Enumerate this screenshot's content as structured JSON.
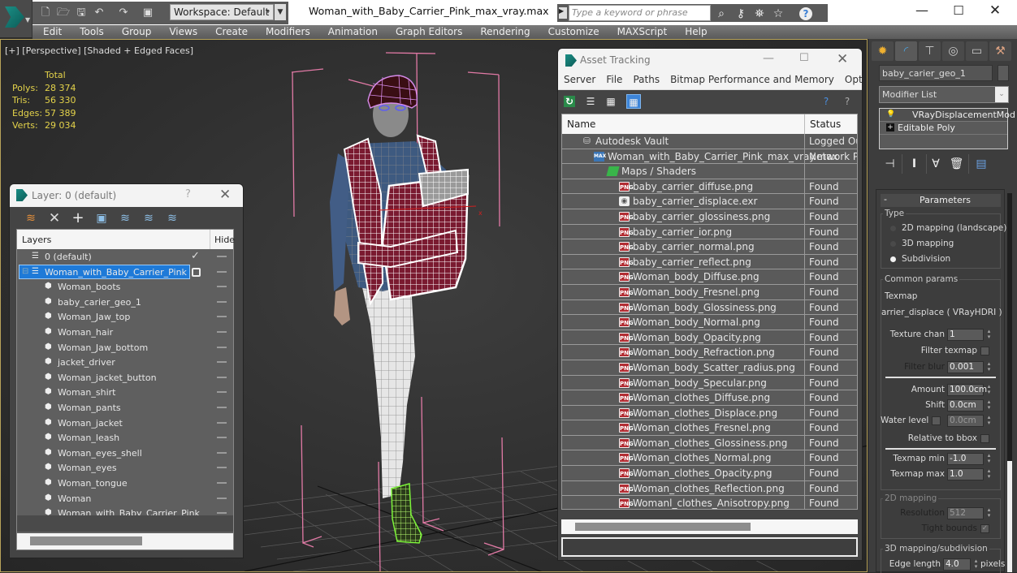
{
  "app": {
    "window_title": "Woman_with_Baby_Carrier_Pink_max_vray.max",
    "workspace": "Workspace: Default",
    "search_placeholder": "Type a keyword or phrase",
    "window_controls": {
      "minimize": "—",
      "maximize": "☐",
      "close": "✕"
    }
  },
  "menu": [
    "Edit",
    "Tools",
    "Group",
    "Views",
    "Create",
    "Modifiers",
    "Animation",
    "Graph Editors",
    "Rendering",
    "Customize",
    "MAXScript",
    "Help"
  ],
  "quick_access_icons": [
    "new-file",
    "open-file",
    "save",
    "undo",
    "redo",
    "project-folder"
  ],
  "toolbar_right_icons": [
    "binoculars",
    "key",
    "satellite",
    "star",
    "help"
  ],
  "viewport": {
    "label": "[+] [Perspective] [Shaded + Edged Faces]",
    "stats": {
      "header": "Total",
      "rows": [
        {
          "label": "Polys:",
          "value": "28 374"
        },
        {
          "label": "Tris:",
          "value": "56 330"
        },
        {
          "label": "Edges:",
          "value": "57 389"
        },
        {
          "label": "Verts:",
          "value": "29 034"
        }
      ]
    },
    "axis_label": "x"
  },
  "layer_dialog": {
    "title": "Layer: 0 (default)",
    "help": "?",
    "close": "✕",
    "tools": [
      "create-layer",
      "delete-layer",
      "add-to-layer",
      "select-objects",
      "highlight-selected",
      "hide-all",
      "freeze-all"
    ],
    "columns": {
      "layers": "Layers",
      "hide": "Hide"
    },
    "rows": [
      {
        "name": "0 (default)",
        "type": "layer",
        "indent": 1,
        "checked": true,
        "selected": false
      },
      {
        "name": "Woman_with_Baby_Carrier_Pink",
        "type": "layer",
        "indent": 1,
        "checked": false,
        "selected": true
      },
      {
        "name": "Woman_boots",
        "type": "object",
        "indent": 2
      },
      {
        "name": "baby_carier_geo_1",
        "type": "object",
        "indent": 2
      },
      {
        "name": "Woman_Jaw_top",
        "type": "object",
        "indent": 2
      },
      {
        "name": "Woman_hair",
        "type": "object",
        "indent": 2
      },
      {
        "name": "Woman_Jaw_bottom",
        "type": "object",
        "indent": 2
      },
      {
        "name": "jacket_driver",
        "type": "object",
        "indent": 2
      },
      {
        "name": "Woman_jacket_button",
        "type": "object",
        "indent": 2
      },
      {
        "name": "Woman_shirt",
        "type": "object",
        "indent": 2
      },
      {
        "name": "Woman_pants",
        "type": "object",
        "indent": 2
      },
      {
        "name": "Woman_jacket",
        "type": "object",
        "indent": 2
      },
      {
        "name": "Woman_leash",
        "type": "object",
        "indent": 2
      },
      {
        "name": "Woman_eyes_shell",
        "type": "object",
        "indent": 2
      },
      {
        "name": "Woman_eyes",
        "type": "object",
        "indent": 2
      },
      {
        "name": "Woman_tongue",
        "type": "object",
        "indent": 2
      },
      {
        "name": "Woman",
        "type": "object",
        "indent": 2
      },
      {
        "name": "Woman_with_Baby_Carrier_Pink",
        "type": "object",
        "indent": 2
      }
    ]
  },
  "asset_tracking": {
    "title": "Asset Tracking",
    "menu": [
      "Server",
      "File",
      "Paths",
      "Bitmap Performance and Memory",
      "Options"
    ],
    "columns": {
      "name": "Name",
      "status": "Status"
    },
    "rows": [
      {
        "name": "Autodesk Vault",
        "status": "Logged Out",
        "icon": "vault",
        "indent": 1
      },
      {
        "name": "Woman_with_Baby_Carrier_Pink_max_vray.max",
        "status": "Network Pa",
        "icon": "max",
        "indent": 2
      },
      {
        "name": "Maps / Shaders",
        "status": "",
        "icon": "maps",
        "indent": 3
      },
      {
        "name": "baby_carrier_diffuse.png",
        "status": "Found",
        "icon": "png",
        "indent": 4
      },
      {
        "name": "baby_carrier_displace.exr",
        "status": "Found",
        "icon": "exr",
        "indent": 4
      },
      {
        "name": "baby_carrier_glossiness.png",
        "status": "Found",
        "icon": "png",
        "indent": 4
      },
      {
        "name": "baby_carrier_ior.png",
        "status": "Found",
        "icon": "png",
        "indent": 4
      },
      {
        "name": "baby_carrier_normal.png",
        "status": "Found",
        "icon": "png",
        "indent": 4
      },
      {
        "name": "baby_carrier_reflect.png",
        "status": "Found",
        "icon": "png",
        "indent": 4
      },
      {
        "name": "Woman_body_Diffuse.png",
        "status": "Found",
        "icon": "png",
        "indent": 4
      },
      {
        "name": "Woman_body_Fresnel.png",
        "status": "Found",
        "icon": "png",
        "indent": 4
      },
      {
        "name": "Woman_body_Glossiness.png",
        "status": "Found",
        "icon": "png",
        "indent": 4
      },
      {
        "name": "Woman_body_Normal.png",
        "status": "Found",
        "icon": "png",
        "indent": 4
      },
      {
        "name": "Woman_body_Opacity.png",
        "status": "Found",
        "icon": "png",
        "indent": 4
      },
      {
        "name": "Woman_body_Refraction.png",
        "status": "Found",
        "icon": "png",
        "indent": 4
      },
      {
        "name": "Woman_body_Scatter_radius.png",
        "status": "Found",
        "icon": "png",
        "indent": 4
      },
      {
        "name": "Woman_body_Specular.png",
        "status": "Found",
        "icon": "png",
        "indent": 4
      },
      {
        "name": "Woman_clothes_Diffuse.png",
        "status": "Found",
        "icon": "png",
        "indent": 4
      },
      {
        "name": "Woman_clothes_Displace.png",
        "status": "Found",
        "icon": "png",
        "indent": 4
      },
      {
        "name": "Woman_clothes_Fresnel.png",
        "status": "Found",
        "icon": "png",
        "indent": 4
      },
      {
        "name": "Woman_clothes_Glossiness.png",
        "status": "Found",
        "icon": "png",
        "indent": 4
      },
      {
        "name": "Woman_clothes_Normal.png",
        "status": "Found",
        "icon": "png",
        "indent": 4
      },
      {
        "name": "Woman_clothes_Opacity.png",
        "status": "Found",
        "icon": "png",
        "indent": 4
      },
      {
        "name": "Woman_clothes_Reflection.png",
        "status": "Found",
        "icon": "png",
        "indent": 4
      },
      {
        "name": "Womanl_clothes_Anisotropy.png",
        "status": "Found",
        "icon": "png",
        "indent": 4
      }
    ]
  },
  "command_panel": {
    "object_name": "baby_carier_geo_1",
    "modifier_list": "Modifier List",
    "stack": [
      {
        "name": "VRayDisplacementMod",
        "icon": "bulb",
        "selected": true
      },
      {
        "name": "Editable Poly",
        "icon": "plus",
        "selected": false
      }
    ],
    "rollout_title": "Parameters",
    "rollout_toggle": "-",
    "type_group": {
      "title": "Type",
      "options": [
        "2D mapping (landscape)",
        "3D mapping",
        "Subdivision"
      ],
      "selected": "Subdivision"
    },
    "common_params": {
      "title": "Common params",
      "texmap_label": "Texmap",
      "texmap_value": "arrier_displace  ( VRayHDRI )",
      "texture_chan_label": "Texture chan",
      "texture_chan": "1",
      "filter_texmap_label": "Filter texmap",
      "filter_texmap": false,
      "filter_blur_label": "Filter blur",
      "filter_blur": "0.001",
      "amount_label": "Amount",
      "amount": "100.0cm",
      "shift_label": "Shift",
      "shift": "0.0cm",
      "water_level_label": "Water level",
      "water_level_enabled": false,
      "water_level": "0.0cm",
      "relative_bbox_label": "Relative to bbox",
      "relative_bbox": false,
      "texmap_min_label": "Texmap min",
      "texmap_min": "-1.0",
      "texmap_max_label": "Texmap max",
      "texmap_max": "1.0"
    },
    "mapping_2d": {
      "title": "2D mapping",
      "resolution_label": "Resolution",
      "resolution": "512",
      "tight_bounds_label": "Tight bounds",
      "tight_bounds": true
    },
    "mapping_3d": {
      "title": "3D mapping/subdivision",
      "edge_length_label": "Edge length",
      "edge_length": "4.0",
      "edge_length_unit": "pixels"
    }
  },
  "colors": {
    "accent_blue": "#1e7ad8",
    "stats_yellow": "#e4d34a",
    "png_icon_red": "#b32d33",
    "bbox_pink": "#e27aa6",
    "boot_select_green": "#7cf23a"
  }
}
